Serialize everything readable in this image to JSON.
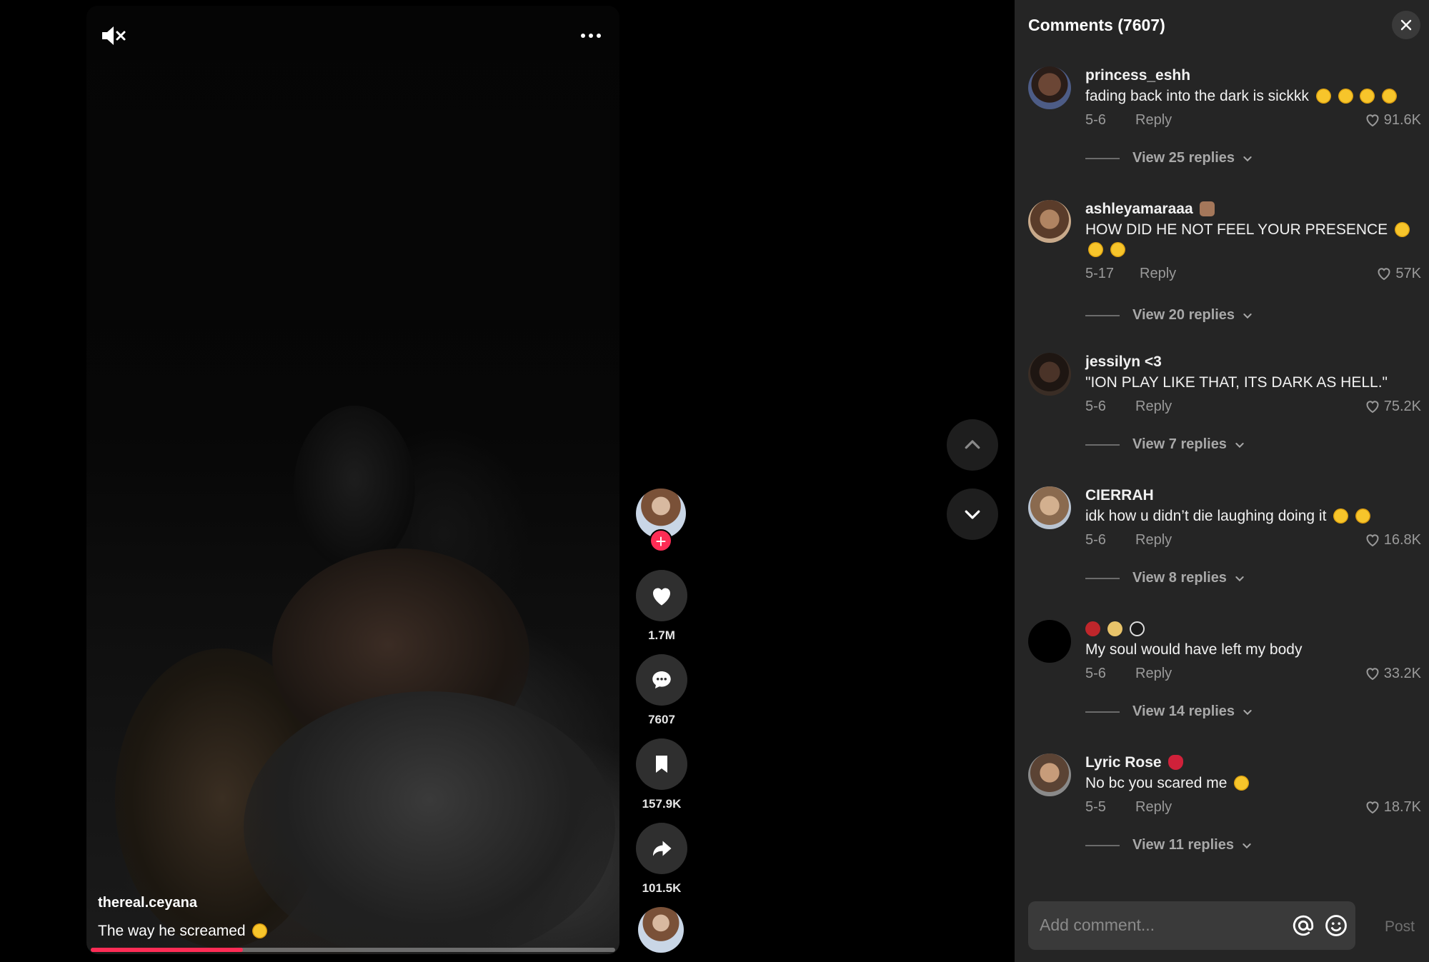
{
  "video": {
    "author": "thereal.ceyana",
    "caption": "The way he screamed",
    "progress": 0.29
  },
  "actions": {
    "likes": "1.7M",
    "comments": "7607",
    "saves": "157.9K",
    "shares": "101.5K",
    "follow_symbol": "+"
  },
  "comments_panel": {
    "title": "Comments (7607)",
    "items": [
      {
        "user": "princess_eshh",
        "text": "fading back into the dark is sickkk",
        "date": "5-6",
        "reply_label": "Reply",
        "likes": "91.6K",
        "replies_label": "View 25 replies"
      },
      {
        "user": "ashleyamaraaa",
        "text": "HOW DID HE NOT FEEL YOUR PRESENCE",
        "date": "5-17",
        "reply_label": "Reply",
        "likes": "57K",
        "replies_label": "View 20 replies"
      },
      {
        "user": "jessilyn <3",
        "text": "\"ION PLAY LIKE THAT, ITS DARK AS HELL.\"",
        "date": "5-6",
        "reply_label": "Reply",
        "likes": "75.2K",
        "replies_label": "View 7 replies"
      },
      {
        "user": "CIERRAH",
        "text": "idk how u didn’t die laughing doing it",
        "date": "5-6",
        "reply_label": "Reply",
        "likes": "16.8K",
        "replies_label": "View 8 replies"
      },
      {
        "user": "",
        "text": "My soul would have left my body",
        "date": "5-6",
        "reply_label": "Reply",
        "likes": "33.2K",
        "replies_label": "View 14 replies"
      },
      {
        "user": "Lyric Rose",
        "text": "No bc you scared me",
        "date": "5-5",
        "reply_label": "Reply",
        "likes": "18.7K",
        "replies_label": "View 11 replies"
      }
    ],
    "input_placeholder": "Add comment...",
    "post_label": "Post"
  }
}
